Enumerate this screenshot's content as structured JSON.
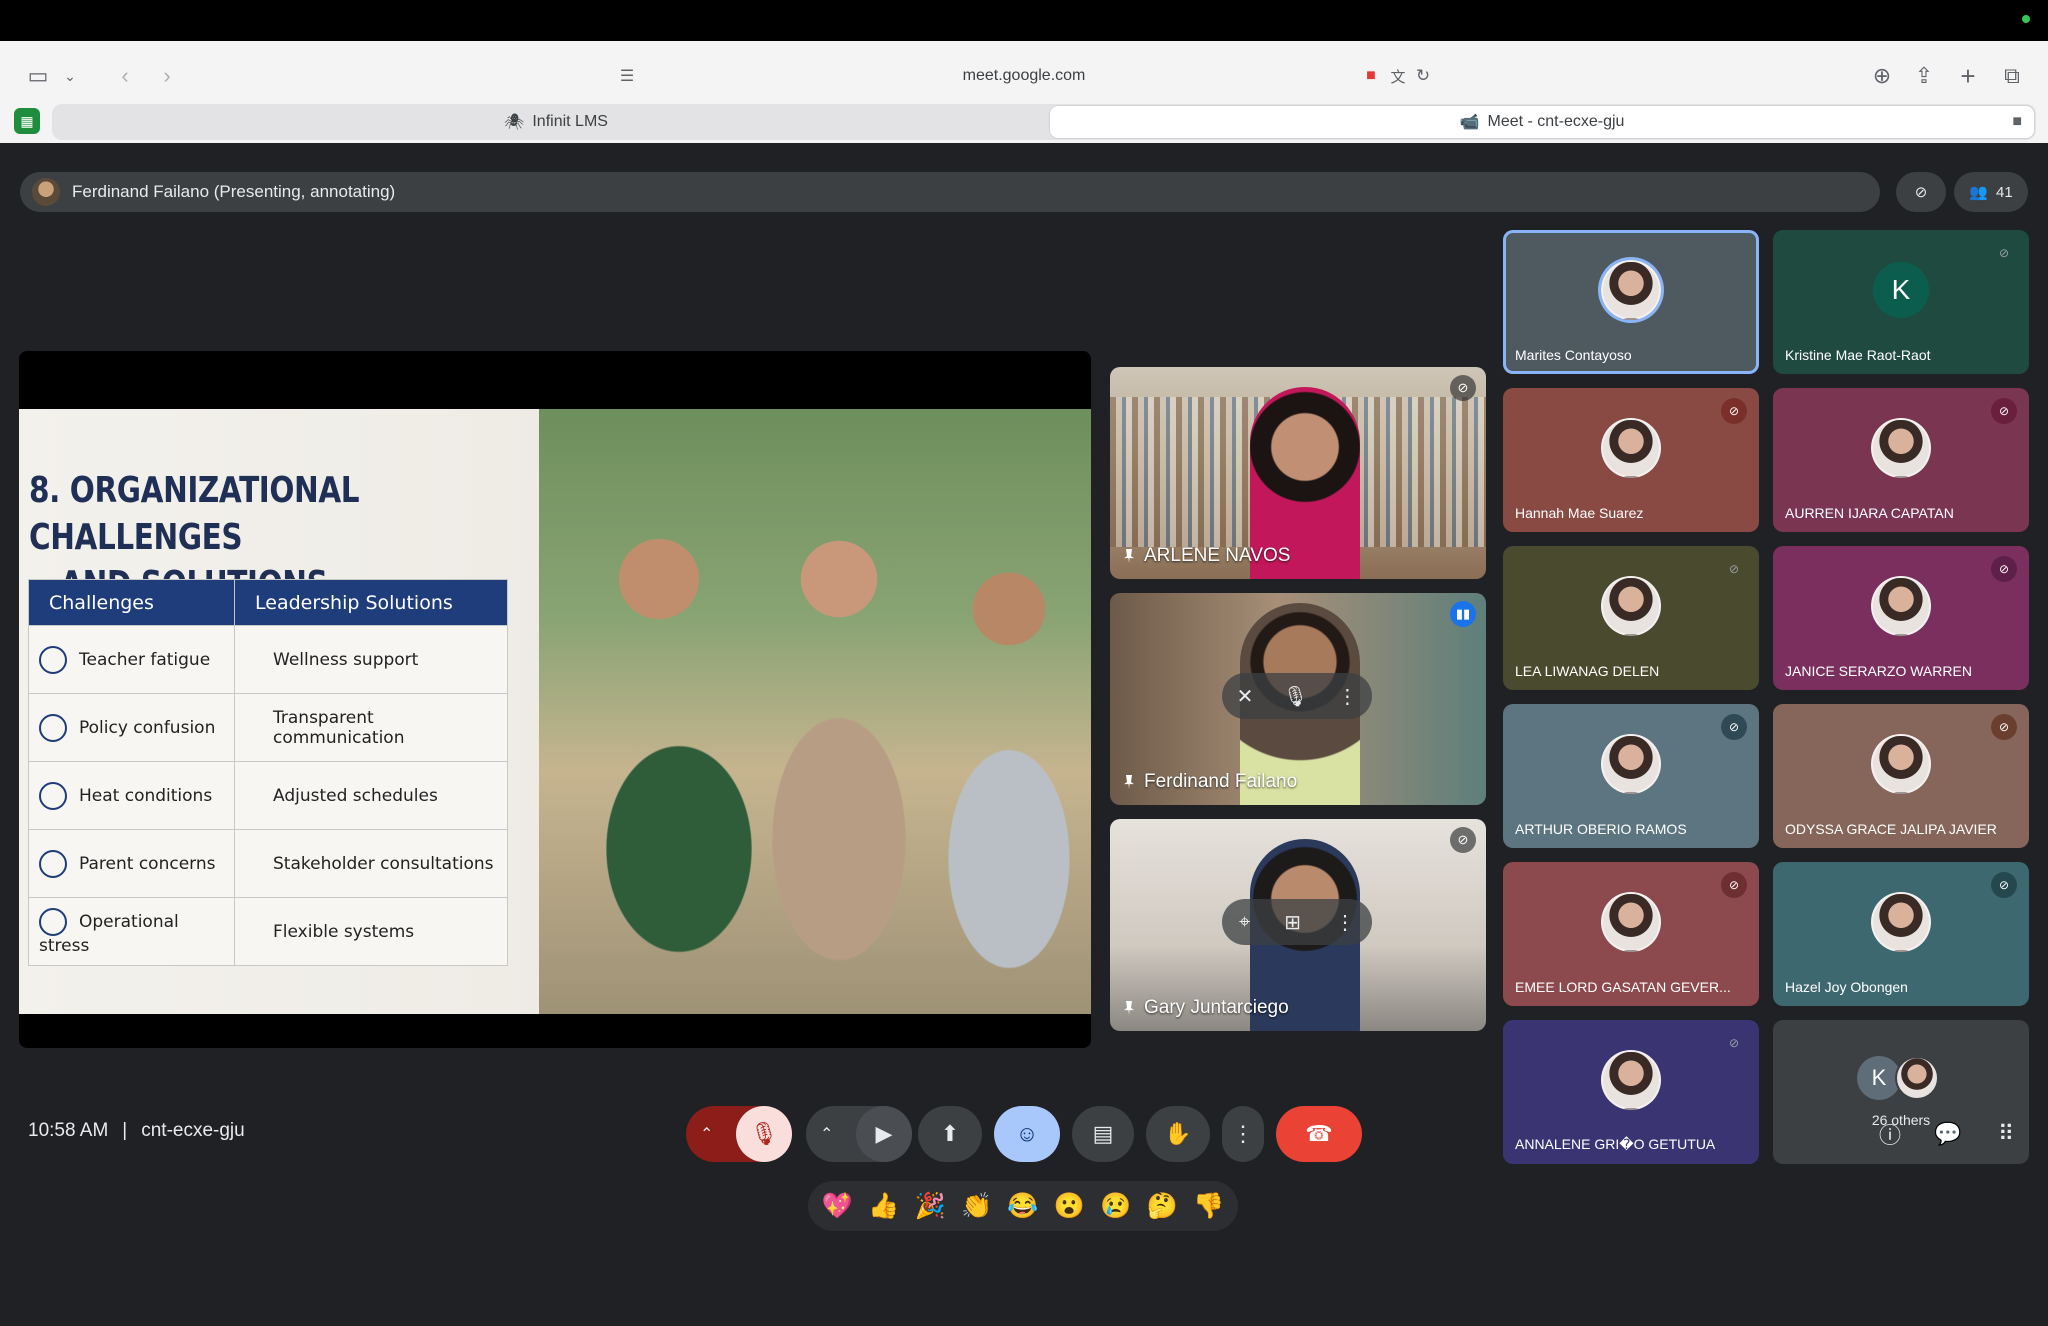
{
  "browser": {
    "url": "meet.google.com",
    "tabs": [
      {
        "label": "Infinit LMS",
        "icon": "🕷"
      },
      {
        "label": "Meet - cnt-ecxe-gju",
        "icon": "📹"
      }
    ]
  },
  "presenter": {
    "label": "Ferdinand Failano (Presenting, annotating)",
    "participants_count": "41"
  },
  "slide": {
    "title_line1": "8. ORGANIZATIONAL CHALLENGES",
    "title_line2": "AND SOLUTIONS",
    "headers": [
      "Challenges",
      "Leadership Solutions"
    ],
    "rows": [
      {
        "challenge": "Teacher fatigue",
        "solution": "Wellness support"
      },
      {
        "challenge": "Policy confusion",
        "solution": "Transparent communication"
      },
      {
        "challenge": "Heat conditions",
        "solution": "Adjusted schedules"
      },
      {
        "challenge": "Parent concerns",
        "solution": "Stakeholder consultations"
      },
      {
        "challenge": "Operational stress",
        "solution": "Flexible systems"
      }
    ]
  },
  "video_tiles": [
    {
      "name": "ARLENE NAVOS"
    },
    {
      "name": "Ferdinand Failano"
    },
    {
      "name": "Gary Juntarciego"
    }
  ],
  "participants": [
    {
      "name": "Marites Contayoso"
    },
    {
      "name": "Kristine Mae Raot-Raot",
      "letter": "K"
    },
    {
      "name": "Hannah Mae Suarez"
    },
    {
      "name": "AURREN IJARA CAPATAN"
    },
    {
      "name": "LEA LIWANAG DELEN"
    },
    {
      "name": "JANICE SERARZO WARREN"
    },
    {
      "name": "ARTHUR OBERIO RAMOS"
    },
    {
      "name": "ODYSSA GRACE JALIPA JAVIER"
    },
    {
      "name": "EMEE LORD GASATAN GEVER..."
    },
    {
      "name": "Hazel Joy Obongen"
    },
    {
      "name": "ANNALENE GRI�O GETUTUA"
    },
    {
      "name": "26 others",
      "letter": "K"
    }
  ],
  "reactions": [
    "💖",
    "👍",
    "🎉",
    "👏",
    "😂",
    "😮",
    "😢",
    "🤔",
    "👎"
  ],
  "footer": {
    "time": "10:58 AM",
    "separator": "|",
    "meeting_code": "cnt-ecxe-gju"
  },
  "colors": {
    "meet_bg": "#202124",
    "active_speaker_border": "#8ab4f8",
    "end_call": "#ea4335",
    "mic_off_bg": "#f9dedc"
  }
}
